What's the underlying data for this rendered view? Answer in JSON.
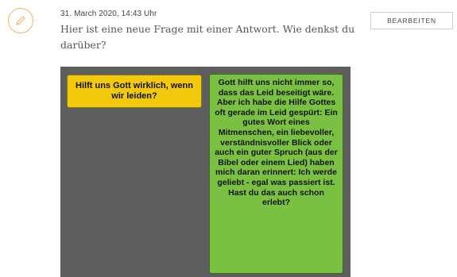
{
  "post": {
    "timestamp": "31. March 2020, 14:43 Uhr",
    "question": "Hier ist eine neue Frage mit einer Antwort. Wie denkst du darüber?"
  },
  "actions": {
    "edit_label": "BEARBEITEN"
  },
  "image": {
    "question_note": "Hilft uns Gott wirklich, wenn wir leiden?",
    "answer_note": "Gott hilft uns nicht immer so, dass das Leid beseitigt wäre. Aber ich habe die Hilfe Gottes oft gerade im Leid gespürt: Ein gutes Wort eines Mitmenschen, ein liebevoller, verständnisvoller Blick oder auch ein guter Spruch (aus der Bibel oder einem Lied) haben mich daran erinnert: Ich werde geliebt - egal was passiert ist. Hast du das auch schon erlebt?"
  },
  "icons": {
    "avatar": "pencil-icon"
  },
  "colors": {
    "avatar_ring": "#f0b56a",
    "image_background": "#5e5e5e",
    "yellow_note": "#f3c90e",
    "green_note": "#7ac143"
  }
}
